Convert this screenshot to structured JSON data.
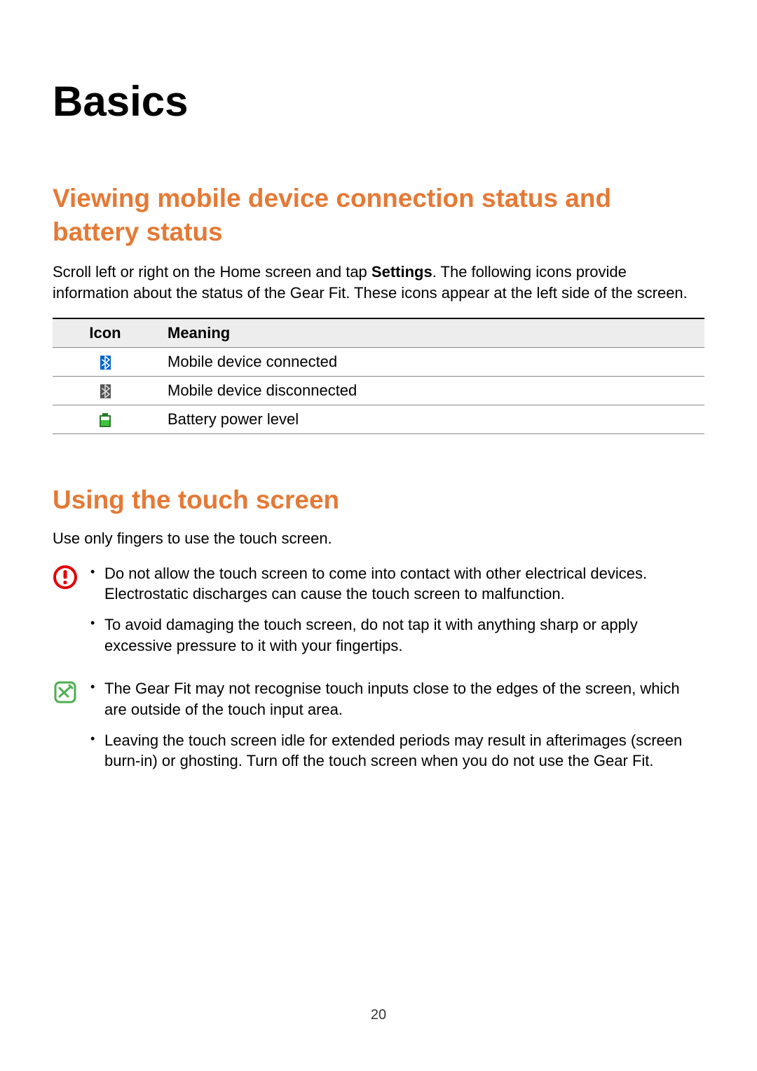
{
  "chapterTitle": "Basics",
  "section1": {
    "title": "Viewing mobile device connection status and battery status",
    "paraPrefix": "Scroll left or right on the Home screen and tap ",
    "paraBold": "Settings",
    "paraSuffix": ". The following icons provide information about the status of the Gear Fit. These icons appear at the left side of the screen.",
    "table": {
      "headIcon": "Icon",
      "headMeaning": "Meaning",
      "rows": [
        {
          "icon": "bt-connected",
          "meaning": "Mobile device connected"
        },
        {
          "icon": "bt-disconnected",
          "meaning": "Mobile device disconnected"
        },
        {
          "icon": "battery",
          "meaning": "Battery power level"
        }
      ]
    }
  },
  "section2": {
    "title": "Using the touch screen",
    "intro": "Use only fingers to use the touch screen.",
    "caution": [
      "Do not allow the touch screen to come into contact with other electrical devices. Electrostatic discharges can cause the touch screen to malfunction.",
      "To avoid damaging the touch screen, do not tap it with anything sharp or apply excessive pressure to it with your fingertips."
    ],
    "note": [
      "The Gear Fit may not recognise touch inputs close to the edges of the screen, which are outside of the touch input area.",
      "Leaving the touch screen idle for extended periods may result in afterimages (screen burn-in) or ghosting. Turn off the touch screen when you do not use the Gear Fit."
    ]
  },
  "pageNumber": "20"
}
